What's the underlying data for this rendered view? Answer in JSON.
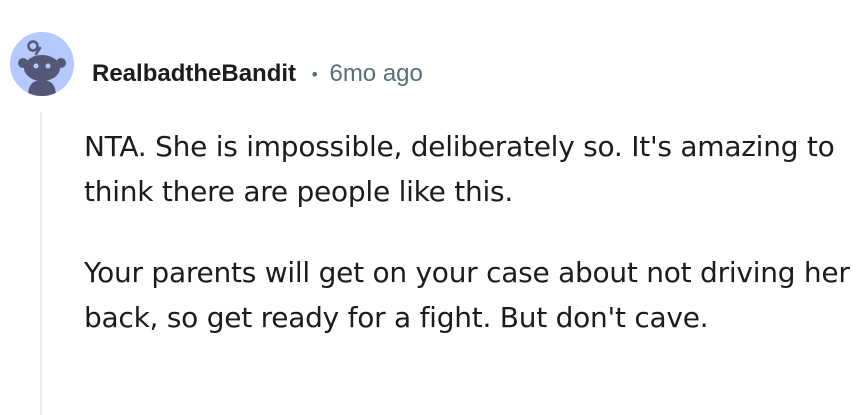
{
  "comment": {
    "username": "RealbadtheBandit",
    "separator": "•",
    "age": "6mo ago",
    "paragraphs": [
      "NTA. She is impossible, deliberately so. It's amazing to think there are people like this.",
      "Your parents will get on your case about not driving her back, so get ready for a fight. But don't cave."
    ]
  },
  "colors": {
    "avatar_bg": "#b6c9ff",
    "avatar_figure": "#545775",
    "meta_text": "#576f76",
    "thread_line": "#e5ebee"
  },
  "icons": {
    "avatar": "snoo-avatar-icon"
  }
}
